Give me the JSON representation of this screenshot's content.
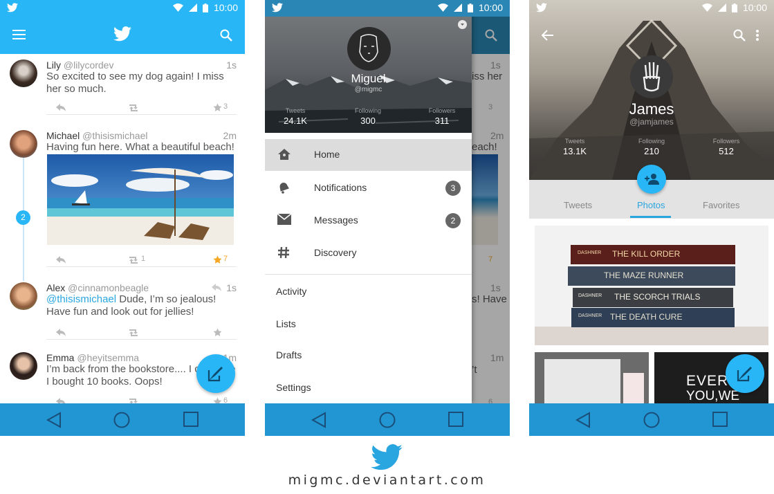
{
  "status": {
    "time": "10:00"
  },
  "timeline": {
    "tweets": [
      {
        "name": "Lily",
        "handle": "@lilycordev",
        "time": "1s",
        "text": "So excited to see my dog again! I miss her so much.",
        "favorites": "3",
        "retweets": ""
      },
      {
        "name": "Michael",
        "handle": "@thisismichael",
        "time": "2m",
        "text": "Having fun here. What a beautiful beach!",
        "favorites": "7",
        "retweets": "1"
      },
      {
        "name": "Alex",
        "handle": "@cinnamonbeagle",
        "time": "1s",
        "mention": "@thisismichael",
        "text": " Dude, I’m so jealous! Have fun and look out for jellies!",
        "favorites": "",
        "retweets": ""
      },
      {
        "name": "Emma",
        "handle": "@heyitsemma",
        "time": "1m",
        "text": "I’m back from the bookstore.... I c believe I bought 10 books. Oops!",
        "favorites": "6",
        "retweets": ""
      }
    ],
    "new_count": "2"
  },
  "drawer": {
    "name": "Miguel",
    "handle": "@migmc",
    "stats": [
      {
        "label": "Tweets",
        "value": "24.1K"
      },
      {
        "label": "Following",
        "value": "300"
      },
      {
        "label": "Followers",
        "value": "311"
      }
    ],
    "items": [
      {
        "label": "Home",
        "badge": ""
      },
      {
        "label": "Notifications",
        "badge": "3"
      },
      {
        "label": "Messages",
        "badge": "2"
      },
      {
        "label": "Discovery",
        "badge": ""
      }
    ],
    "secondary": [
      "Activity",
      "Lists",
      "Drafts",
      "Settings"
    ],
    "behind": {
      "times": [
        "1s",
        "2m",
        "1s",
        "1m"
      ],
      "snips": [
        "iss her",
        "each!",
        "s! Have",
        "’t"
      ],
      "counts": [
        "3",
        "7",
        "6"
      ]
    }
  },
  "profile": {
    "name": "James",
    "handle": "@jamjames",
    "stats": [
      {
        "label": "Tweets",
        "value": "13.1K"
      },
      {
        "label": "Following",
        "value": "210"
      },
      {
        "label": "Followers",
        "value": "512"
      }
    ],
    "tabs": [
      "Tweets",
      "Photos",
      "Favorites"
    ],
    "books": [
      "THE KILL ORDER",
      "THE MAZE RUNNER",
      "THE SCORCH TRIALS",
      "THE DEATH CURE"
    ],
    "book_brand": "DASHNER",
    "poster": [
      "EVER",
      "YOU,WE"
    ]
  },
  "footer": {
    "text": "migmc.deviantart.com"
  },
  "colors": {
    "accent": "#29b6f6",
    "navbar": "#2196d3",
    "favorite": "#f5a623"
  }
}
